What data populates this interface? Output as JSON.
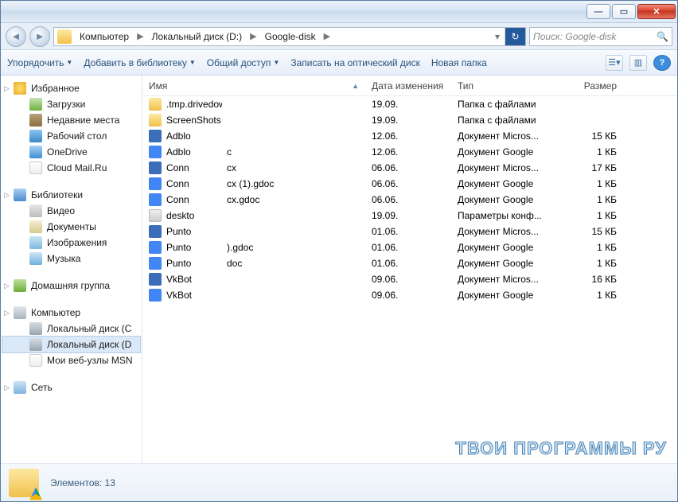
{
  "titlebar": {
    "min": "—",
    "max": "▭",
    "close": "✕"
  },
  "nav": {
    "back": "◄",
    "forward": "►",
    "crumbs": [
      "Компьютер",
      "Локальный диск (D:)",
      "Google-disk"
    ],
    "refresh": "↻",
    "search_placeholder": "Поиск: Google-disk"
  },
  "toolbar": {
    "organize": "Упорядочить",
    "include": "Добавить в библиотеку",
    "share": "Общий доступ",
    "burn": "Записать на оптический диск",
    "newfolder": "Новая папка"
  },
  "columns": {
    "name": "Имя",
    "date": "Дата изменения",
    "type": "Тип",
    "size": "Размер"
  },
  "sidebar": {
    "favorites": {
      "label": "Избранное",
      "items": [
        {
          "icon": "ic-dl",
          "label": "Загрузки"
        },
        {
          "icon": "ic-recent",
          "label": "Недавние места"
        },
        {
          "icon": "ic-desktop",
          "label": "Рабочий стол"
        },
        {
          "icon": "ic-onedrive",
          "label": "OneDrive"
        },
        {
          "icon": "ic-mailru",
          "label": "Cloud Mail.Ru"
        }
      ]
    },
    "libraries": {
      "label": "Библиотеки",
      "items": [
        {
          "icon": "ic-video",
          "label": "Видео"
        },
        {
          "icon": "ic-docs",
          "label": "Документы"
        },
        {
          "icon": "ic-pics",
          "label": "Изображения"
        },
        {
          "icon": "ic-music",
          "label": "Музыка"
        }
      ]
    },
    "homegroup": {
      "label": "Домашняя группа"
    },
    "computer": {
      "label": "Компьютер",
      "items": [
        {
          "icon": "ic-drive",
          "label": "Локальный диск (C"
        },
        {
          "icon": "ic-drive",
          "label": "Локальный диск (D",
          "selected": true
        },
        {
          "icon": "ic-ie",
          "label": "Мои веб-узлы MSN"
        }
      ]
    },
    "network": {
      "label": "Сеть"
    }
  },
  "files": [
    {
      "icon": "fic-folder",
      "name": ".tmp.drivedownload",
      "suffix": "",
      "date": "19.09.",
      "type": "Папка с файлами",
      "size": ""
    },
    {
      "icon": "fic-folder",
      "name": "ScreenShots",
      "suffix": "",
      "date": "19.09.",
      "type": "Папка с файлами",
      "size": ""
    },
    {
      "icon": "fic-word",
      "name": "Adblo",
      "suffix": "",
      "date": "12.06.",
      "type": "Документ Micros...",
      "size": "15 КБ"
    },
    {
      "icon": "fic-gdoc",
      "name": "Adblo",
      "suffix": "c",
      "date": "12.06.",
      "type": "Документ Google",
      "size": "1 КБ"
    },
    {
      "icon": "fic-word",
      "name": "Conn",
      "suffix": "cx",
      "date": "06.06.",
      "type": "Документ Micros...",
      "size": "17 КБ"
    },
    {
      "icon": "fic-gdoc",
      "name": "Conn",
      "suffix": "cx (1).gdoc",
      "date": "06.06.",
      "type": "Документ Google",
      "size": "1 КБ"
    },
    {
      "icon": "fic-gdoc",
      "name": "Conn",
      "suffix": "cx.gdoc",
      "date": "06.06.",
      "type": "Документ Google",
      "size": "1 КБ"
    },
    {
      "icon": "fic-ini",
      "name": "deskto",
      "suffix": "",
      "date": "19.09.",
      "type": "Параметры конф...",
      "size": "1 КБ"
    },
    {
      "icon": "fic-word",
      "name": "Punto",
      "suffix": "",
      "date": "01.06.",
      "type": "Документ Micros...",
      "size": "15 КБ"
    },
    {
      "icon": "fic-gdoc",
      "name": "Punto",
      "suffix": ").gdoc",
      "date": "01.06.",
      "type": "Документ Google",
      "size": "1 КБ"
    },
    {
      "icon": "fic-gdoc",
      "name": "Punto",
      "suffix": "doc",
      "date": "01.06.",
      "type": "Документ Google",
      "size": "1 КБ"
    },
    {
      "icon": "fic-word",
      "name": "VkBot",
      "suffix": "",
      "date": "09.06.",
      "type": "Документ Micros...",
      "size": "16 КБ"
    },
    {
      "icon": "fic-gdoc",
      "name": "VkBot",
      "suffix": "",
      "date": "09.06.",
      "type": "Документ Google",
      "size": "1 КБ"
    }
  ],
  "status": {
    "label": "Элементов: 13"
  },
  "watermark": "ТВОИ ПРОГРАММЫ РУ"
}
